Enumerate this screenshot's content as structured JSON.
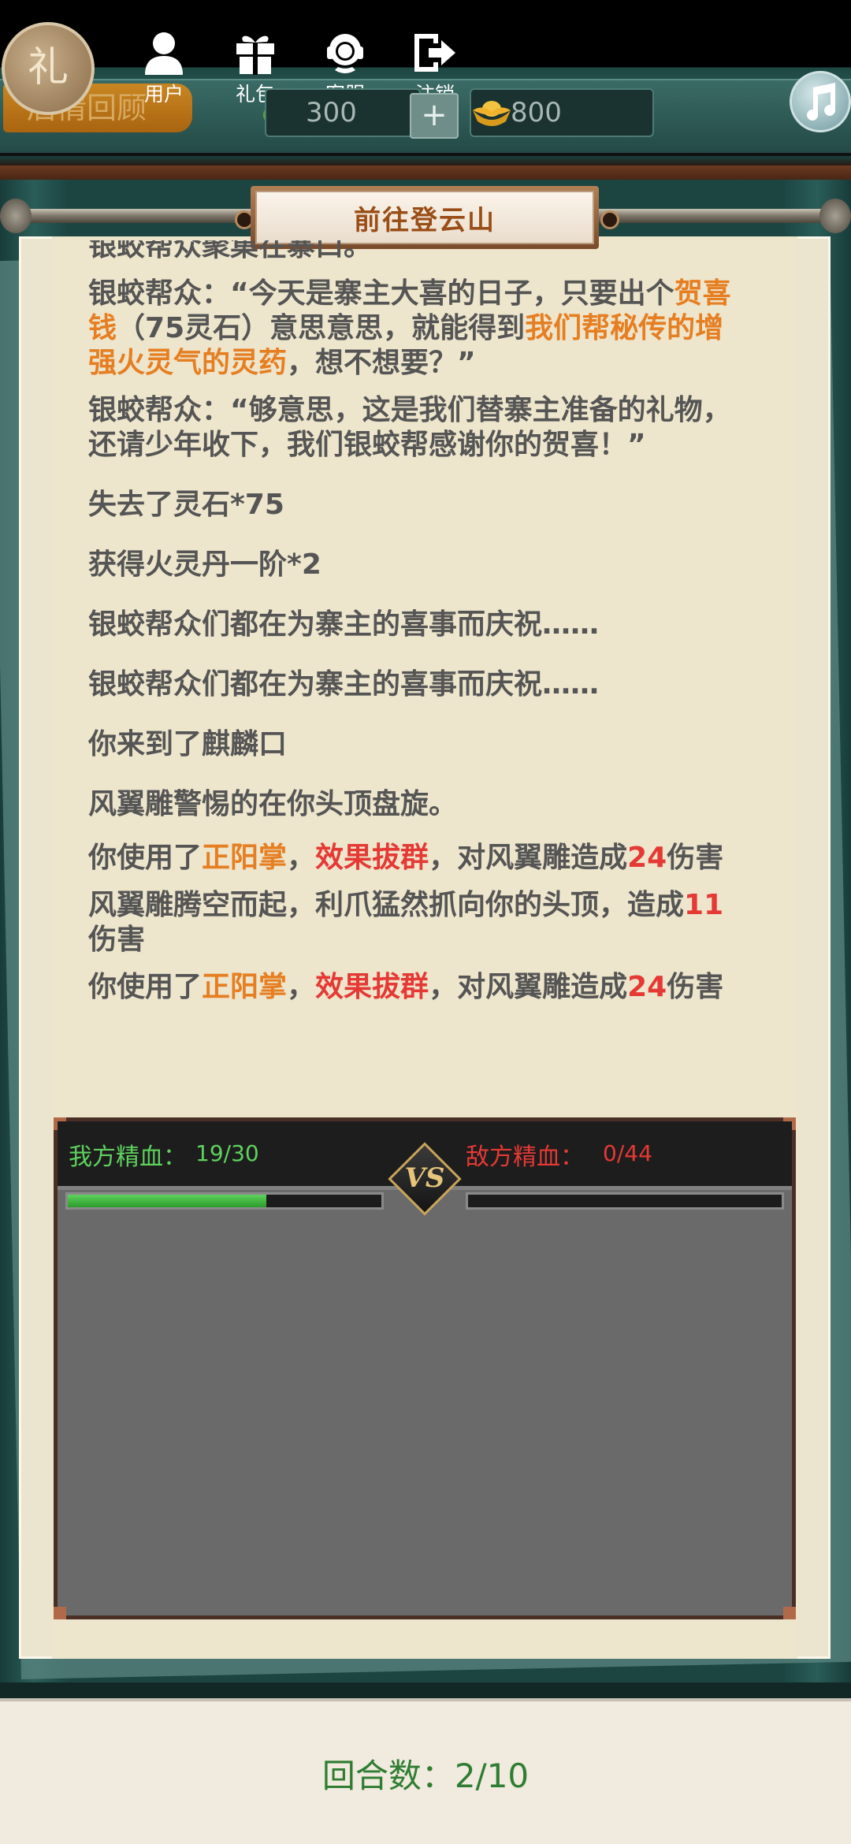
{
  "hud": {
    "gift_circle": "礼",
    "recall_tab": "后情回顾",
    "nav": [
      {
        "label": "用户",
        "icon": "user-icon"
      },
      {
        "label": "礼包",
        "icon": "gift-icon"
      },
      {
        "label": "客服",
        "icon": "support-icon"
      },
      {
        "label": "注销",
        "icon": "logout-icon"
      }
    ],
    "jade": "300",
    "plus": "+",
    "gold": "800"
  },
  "title": "前往登云山",
  "log": {
    "l0": "银蛟帮众聚集在寨口。",
    "l1a": "银蛟帮众：“今天是寨主大喜的日子，只要出个",
    "l1b": "贺喜钱",
    "l1c": "（75灵石）意思意思，就能得到",
    "l1d": "我们帮秘传的增强火灵气的灵药",
    "l1e": "，想不想要？”",
    "l2": "银蛟帮众：“够意思，这是我们替寨主准备的礼物，还请少年收下，我们银蛟帮感谢你的贺喜！”",
    "l3": "失去了灵石*75",
    "l4": "获得火灵丹一阶*2",
    "l5": "银蛟帮众们都在为寨主的喜事而庆祝……",
    "l6": "银蛟帮众们都在为寨主的喜事而庆祝……",
    "l7": "你来到了麒麟口",
    "l8": "风翼雕警惕的在你头顶盘旋。",
    "l9a": "你使用了",
    "l9b": "正阳掌",
    "l9c": "，",
    "l9d": "效果拔群",
    "l9e": "，对风翼雕造成",
    "l9f": "24",
    "l9g": "伤害",
    "l10a": "风翼雕腾空而起，利爪猛然抓向你的头顶，造成",
    "l10b": "11",
    "l10c": "伤害",
    "l11a": "你使用了",
    "l11b": "正阳掌",
    "l11c": "，",
    "l11d": "效果拔群",
    "l11e": "，对风翼雕造成",
    "l11f": "24",
    "l11g": "伤害"
  },
  "battle": {
    "my_label": "我方精血：",
    "my_value": "19/30",
    "my_hp_fraction": 0.633,
    "enemy_label": "敌方精血：",
    "enemy_value": "0/44",
    "enemy_hp_fraction": 0,
    "vs": "VS"
  },
  "round_text": "回合数：2/10",
  "colors": {
    "orange": "#e67e22",
    "red": "#e53935",
    "pink": "#f08ab0",
    "blue": "#3b9ee6",
    "hp_green": "#4ec04e",
    "round_green": "#2e7d32"
  }
}
